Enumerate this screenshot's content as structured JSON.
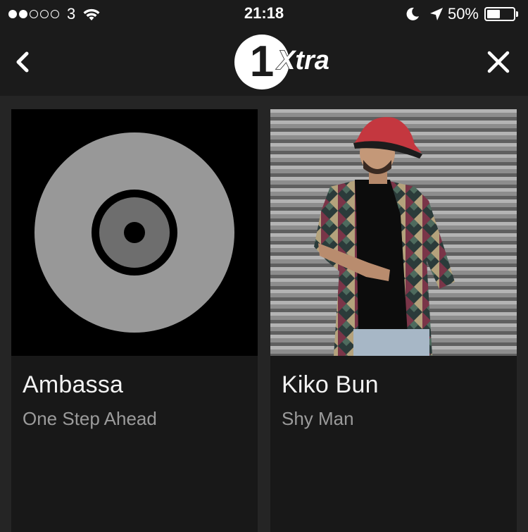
{
  "status_bar": {
    "signal_dots_filled": 2,
    "signal_dots_total": 5,
    "carrier": "3",
    "time": "21:18",
    "battery_percent_label": "50%",
    "battery_level": 0.5,
    "icons": [
      "wifi-icon",
      "moon-icon",
      "location-arrow-icon",
      "battery-icon"
    ]
  },
  "nav": {
    "back_icon": "chevron-left-icon",
    "close_icon": "close-icon",
    "logo": {
      "number": "1",
      "word": "Xtra",
      "colors": {
        "badge": "#ffffff",
        "number": "#1b1b1b",
        "word": "#ffffff"
      }
    }
  },
  "cards": [
    {
      "artist": "Ambassa",
      "track": "One Step Ahead",
      "art": "placeholder-disc"
    },
    {
      "artist": "Kiko Bun",
      "track": "Shy Man",
      "art": "artist-photo"
    }
  ],
  "colors": {
    "background": "#252525",
    "bars": "#1b1b1b",
    "card": "#181818",
    "artist_text": "#f2f2f2",
    "track_text": "#9b9b9b"
  }
}
